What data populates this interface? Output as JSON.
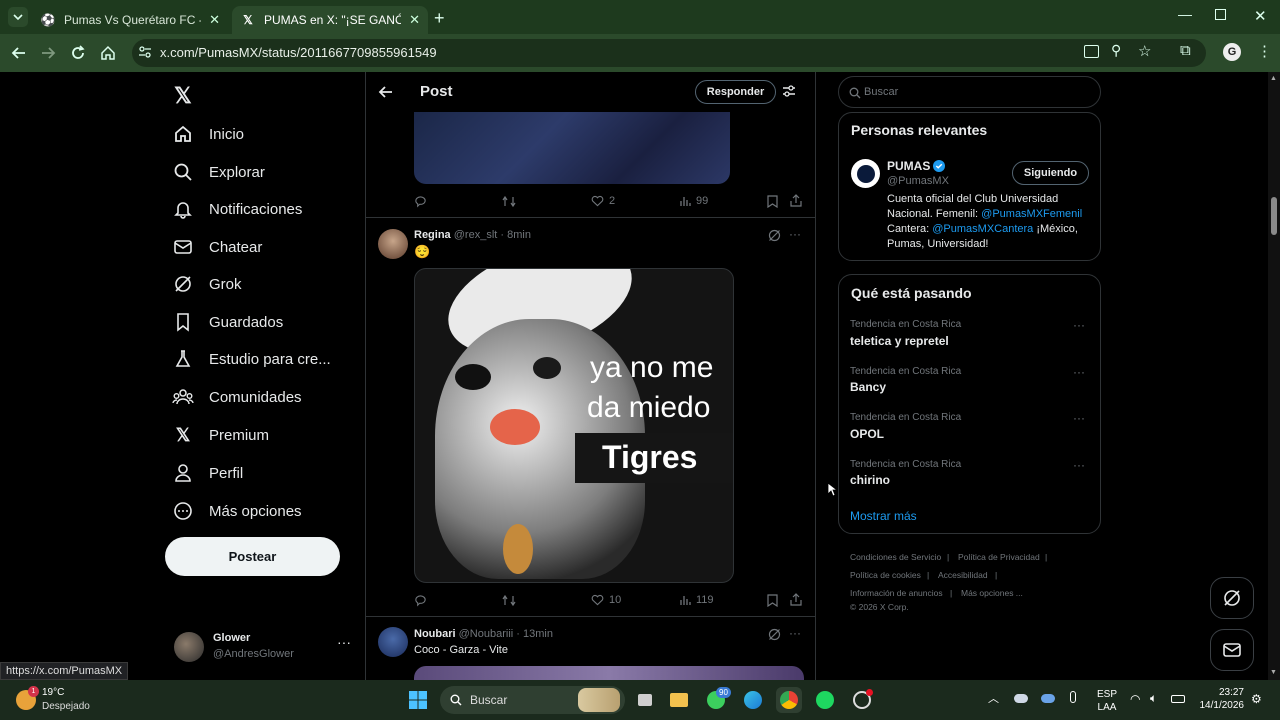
{
  "browser": {
    "tabs": [
      {
        "title": "Pumas Vs Querétaro FC - Alinea",
        "active": false
      },
      {
        "title": "PUMAS en X: \"¡SE GANÓ EN EL",
        "active": true
      }
    ],
    "url": "x.com/PumasMX/status/2011667709855961549",
    "profile_initial": "G"
  },
  "sidebar": {
    "items": [
      {
        "label": "Inicio",
        "icon": "home-icon"
      },
      {
        "label": "Explorar",
        "icon": "search-icon"
      },
      {
        "label": "Notificaciones",
        "icon": "bell-icon"
      },
      {
        "label": "Chatear",
        "icon": "mail-icon"
      },
      {
        "label": "Grok",
        "icon": "grok-icon"
      },
      {
        "label": "Guardados",
        "icon": "bookmark-icon"
      },
      {
        "label": "Estudio para cre...",
        "icon": "flask-icon"
      },
      {
        "label": "Comunidades",
        "icon": "people-icon"
      },
      {
        "label": "Premium",
        "icon": "x-logo-icon"
      },
      {
        "label": "Perfil",
        "icon": "person-icon"
      },
      {
        "label": "Más opciones",
        "icon": "more-circle-icon"
      }
    ],
    "post_button": "Postear",
    "account": {
      "name": "Glower",
      "handle": "@AndresGlower"
    }
  },
  "header": {
    "title": "Post",
    "reply_button": "Responder"
  },
  "posts": [
    {
      "actions": {
        "replies": "",
        "retweets": "",
        "likes": "2",
        "views": "99"
      }
    },
    {
      "author": "Regina",
      "handle": "@rex_slt",
      "time": "8min",
      "text": "😌",
      "image_text": {
        "line1": "ya no me",
        "line2": "da miedo",
        "label": "Tigres"
      },
      "actions": {
        "replies": "",
        "retweets": "",
        "likes": "10",
        "views": "119"
      }
    },
    {
      "author": "Noubari",
      "handle": "@Noubariii",
      "time": "13min",
      "text": "Coco - Garza - Vite"
    }
  ],
  "right": {
    "search_placeholder": "Buscar",
    "relevant_title": "Personas relevantes",
    "relevant_person": {
      "name": "PUMAS",
      "handle": "@PumasMX",
      "follow_button": "Siguiendo",
      "bio_1": "Cuenta oficial del Club Universidad",
      "bio_2a": "Nacional. Femenil: ",
      "bio_2b": "@PumasMXFemenil",
      "bio_3a": "Cantera: ",
      "bio_3b": "@PumasMXCantera",
      "bio_3c": " ¡México,",
      "bio_4": "Pumas, Universidad!"
    },
    "trends_title": "Qué está pasando",
    "trends": [
      {
        "category": "Tendencia en Costa Rica",
        "name": "teletica y repretel"
      },
      {
        "category": "Tendencia en Costa Rica",
        "name": "Bancy"
      },
      {
        "category": "Tendencia en Costa Rica",
        "name": "OPOL"
      },
      {
        "category": "Tendencia en Costa Rica",
        "name": "chirino"
      }
    ],
    "show_more": "Mostrar más",
    "footer": {
      "terms": "Condiciones de Servicio",
      "privacy": "Política de Privacidad",
      "cookies": "Política de cookies",
      "accessibility": "Accesibilidad",
      "ads": "Información de anuncios",
      "more": "Más opciones ...",
      "copyright": "© 2026 X Corp."
    }
  },
  "status_url": "https://x.com/PumasMX",
  "taskbar": {
    "weather_temp": "19°C",
    "weather_desc": "Despejado",
    "search": "Buscar",
    "lang_1": "ESP",
    "lang_2": "LAA",
    "time": "23:27",
    "date": "14/1/2026",
    "badge_count": "90"
  },
  "colors": {
    "accent": "#1d9bf0",
    "verified": "#1d9bf0",
    "bg": "#000000",
    "border": "#2f3336"
  }
}
